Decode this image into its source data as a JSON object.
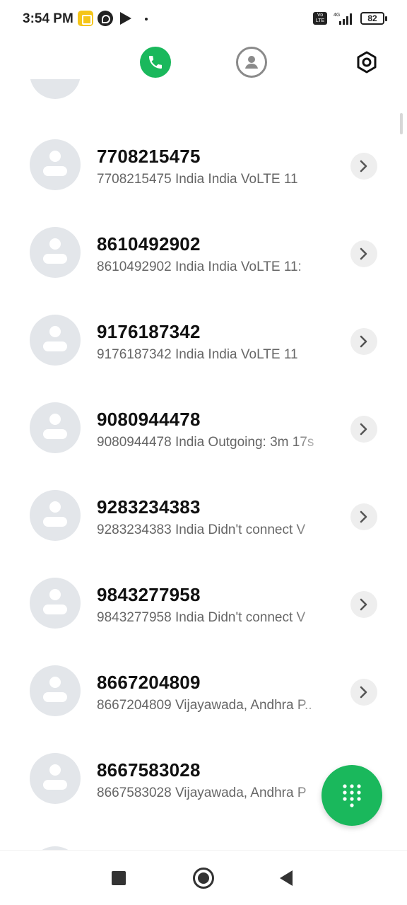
{
  "status_bar": {
    "time": "3:54 PM",
    "network": "4G",
    "volte_label": "Vo LTE",
    "battery": "82"
  },
  "tabs": [
    {
      "name": "calls",
      "icon": "phone-icon",
      "active": true
    },
    {
      "name": "contacts",
      "icon": "person-icon",
      "active": false
    },
    {
      "name": "settings",
      "icon": "settings-icon",
      "active": false
    }
  ],
  "calls": [
    {
      "number": "7708215475",
      "detail": "7708215475 India India VoLTE  11"
    },
    {
      "number": "8610492902",
      "detail": "8610492902 India India VoLTE  11:"
    },
    {
      "number": "9176187342",
      "detail": "9176187342 India India VoLTE  11"
    },
    {
      "number": "9080944478",
      "detail": "9080944478 India Outgoing: 3m 17s"
    },
    {
      "number": "9283234383",
      "detail": "9283234383 India Didn't connect V"
    },
    {
      "number": "9843277958",
      "detail": "9843277958 India Didn't connect V"
    },
    {
      "number": "8667204809",
      "detail": "8667204809 Vijayawada, Andhra P.."
    },
    {
      "number": "8667583028",
      "detail": "8667583028 Vijayawada, Andhra P"
    }
  ],
  "colors": {
    "accent_green": "#1ab85c",
    "missed_red": "#e5533d",
    "avatar_gray": "#e3e6ea"
  },
  "fab": {
    "icon": "dialpad-icon"
  },
  "navbar": {
    "recents_icon": "square-icon",
    "home_icon": "circle-icon",
    "back_icon": "triangle-back-icon"
  }
}
